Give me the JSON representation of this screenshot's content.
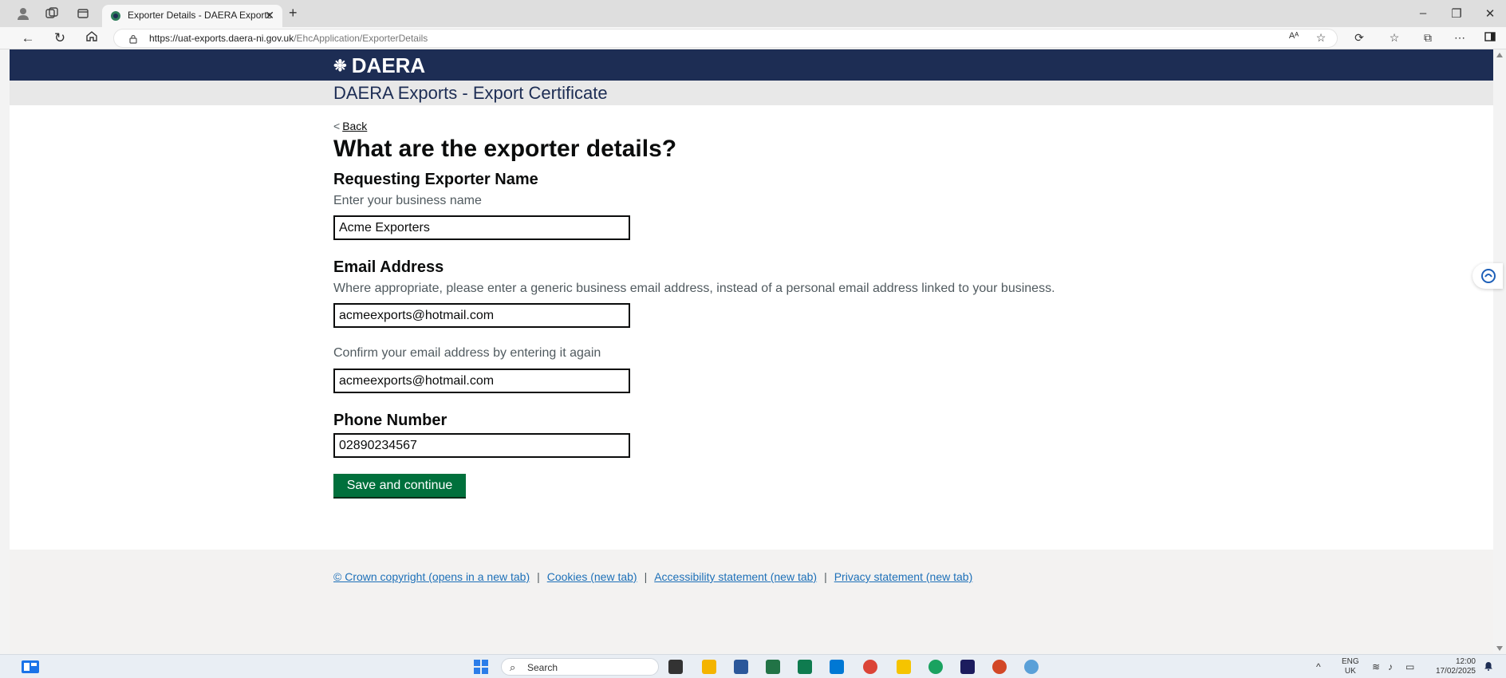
{
  "browser": {
    "tab_title": "Exporter Details - DAERA Exports",
    "url_host": "https://uat-exports.daera-ni.gov.uk",
    "url_path": "/EhcApplication/ExporterDetails"
  },
  "site": {
    "logo_text": "DAERA",
    "service_name": "DAERA Exports - Export Certificate"
  },
  "page": {
    "back_label": "Back",
    "heading": "What are the exporter details?",
    "exporter_name": {
      "label": "Requesting Exporter Name",
      "hint": "Enter your business name",
      "value": "Acme Exporters"
    },
    "email": {
      "label": "Email Address",
      "hint": "Where appropriate, please enter a generic business email address, instead of a personal email address linked to your business.",
      "value": "acmeexports@hotmail.com",
      "confirm_hint": "Confirm your email address by entering it again",
      "confirm_value": "acmeexports@hotmail.com"
    },
    "phone": {
      "label": "Phone Number",
      "value": "02890234567"
    },
    "submit_label": "Save and continue"
  },
  "footer": {
    "links": [
      "© Crown copyright (opens in a new tab)",
      "Cookies (new tab)",
      "Accessibility statement (new tab)",
      "Privacy statement (new tab)"
    ]
  },
  "taskbar": {
    "search_placeholder": "Search",
    "lang_primary": "ENG",
    "lang_secondary": "UK",
    "time": "12:00",
    "date": "17/02/2025"
  },
  "colors": {
    "header_bg": "#1d2d54",
    "button_green": "#00703c",
    "link_blue": "#1d70b8"
  }
}
